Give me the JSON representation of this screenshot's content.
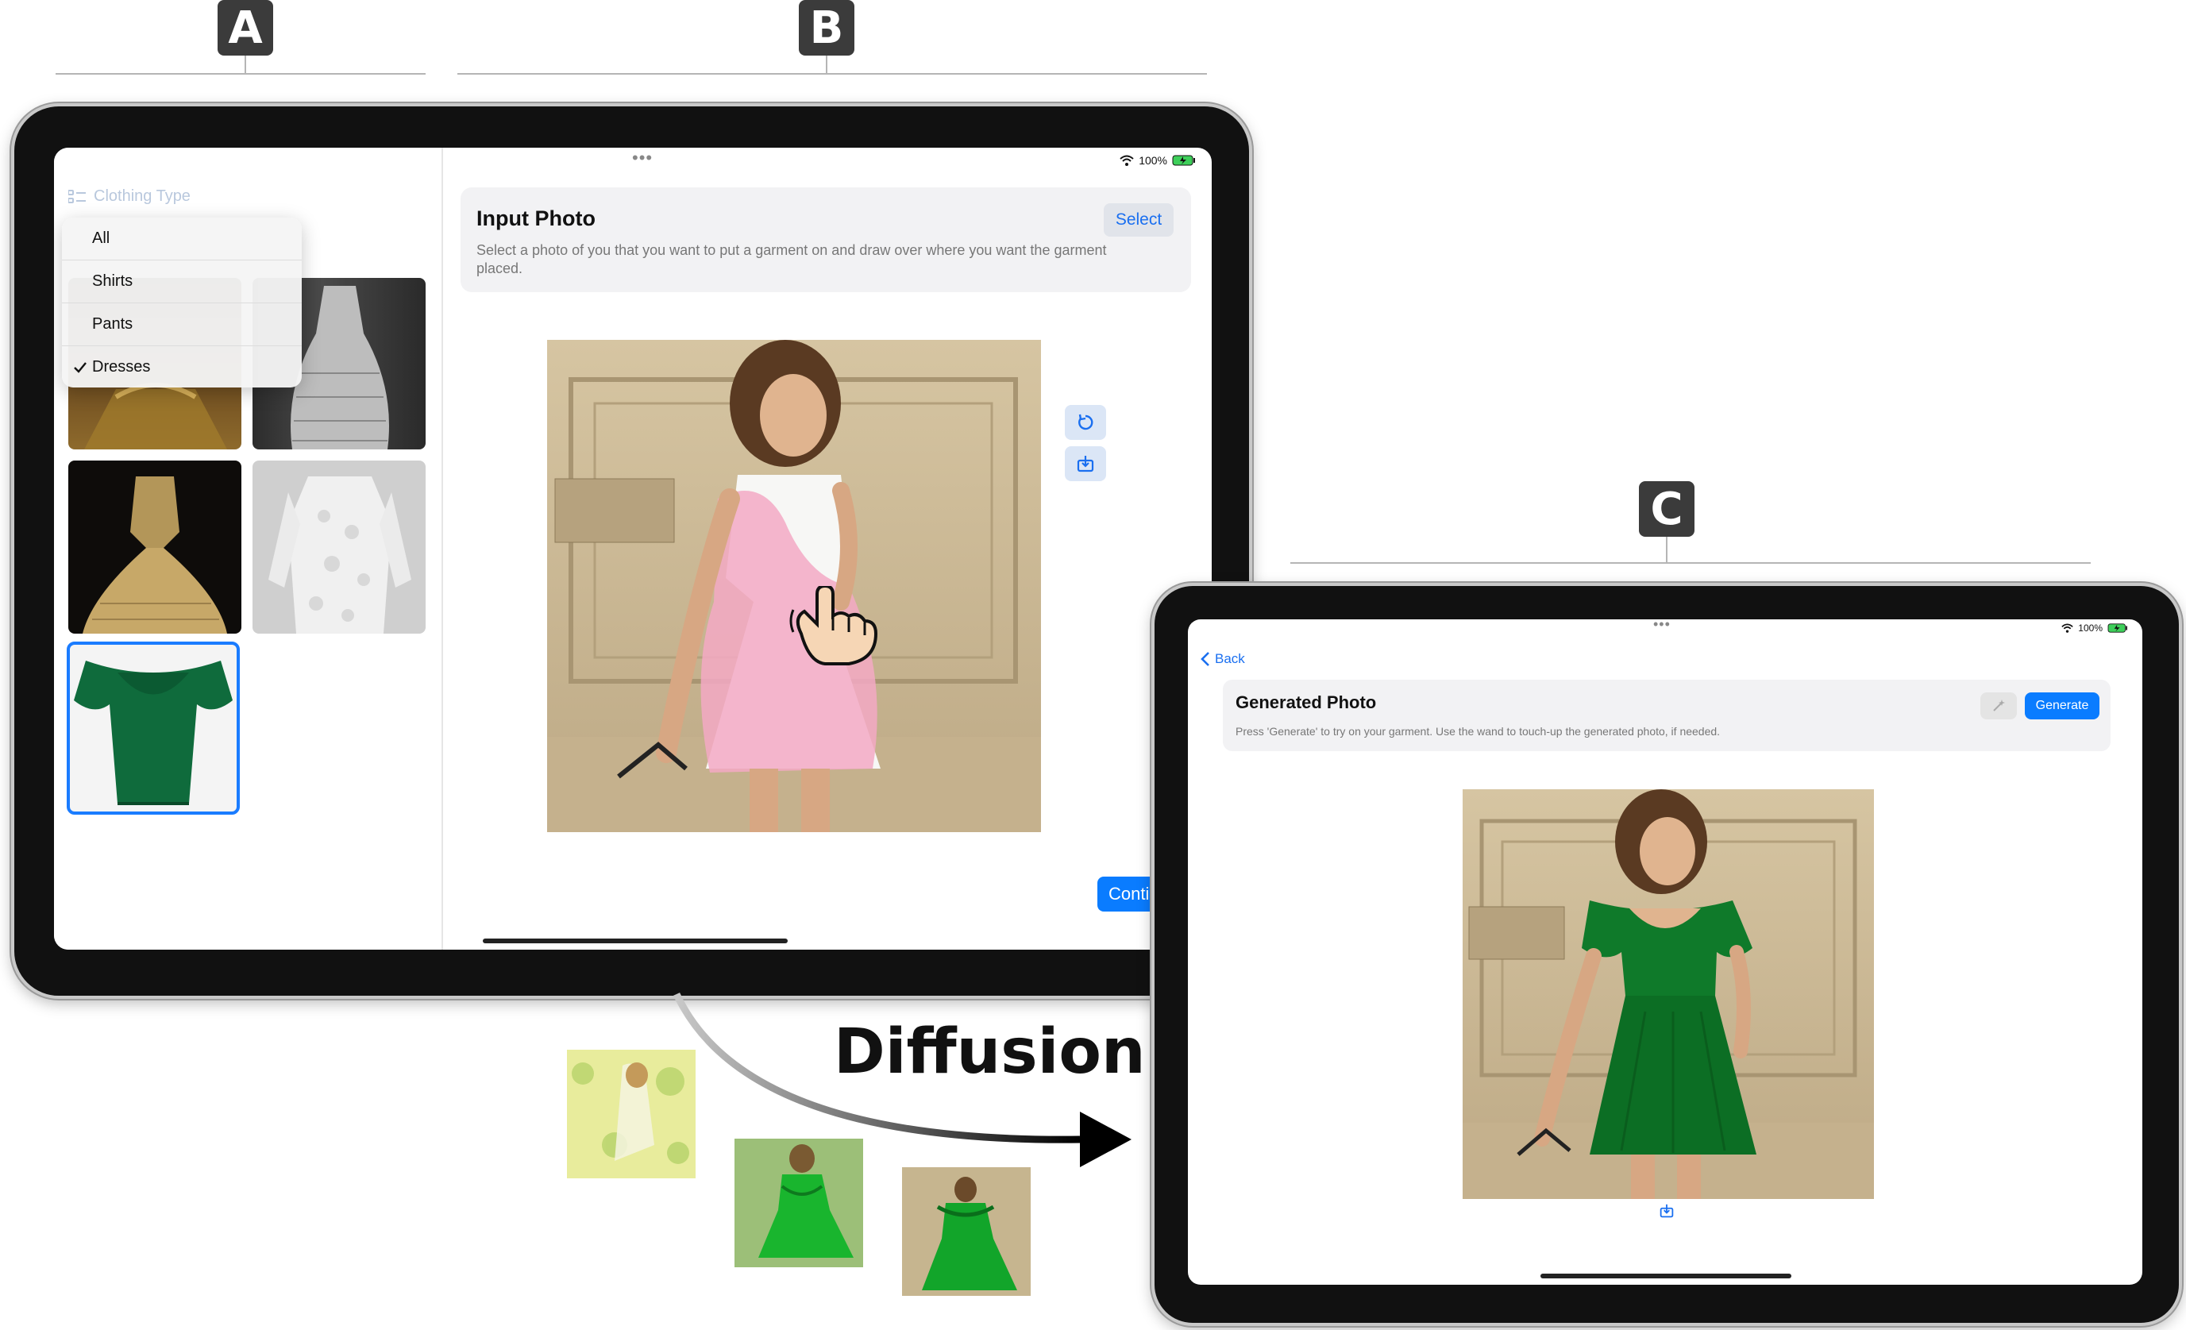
{
  "labels": {
    "a": "A",
    "b": "B",
    "c": "C"
  },
  "screen_ab": {
    "status": {
      "battery_text": "100%"
    },
    "sidebar": {
      "header": "Clothing Type",
      "menu": [
        {
          "label": "All",
          "checked": false
        },
        {
          "label": "Shirts",
          "checked": false
        },
        {
          "label": "Pants",
          "checked": false
        },
        {
          "label": "Dresses",
          "checked": true
        }
      ]
    },
    "input_card": {
      "title": "Input Photo",
      "description": "Select a photo of you that you want to put a garment on and draw over where you want the garment placed.",
      "select_label": "Select"
    },
    "continue_label": "Conti"
  },
  "diffusion_label": "Diffusion",
  "screen_c": {
    "status": {
      "battery_text": "100%"
    },
    "back_label": "Back",
    "generated_card": {
      "title": "Generated Photo",
      "description": "Press 'Generate' to try on your garment. Use the wand to touch-up the generated photo, if needed.",
      "generate_label": "Generate"
    }
  },
  "colors": {
    "accent_blue": "#0a7cff",
    "dress_green": "#0f7a3c",
    "mask_pink": "#f3a9c4",
    "label_dark": "#3b3b3b"
  },
  "icons": [
    "wifi-icon",
    "battery-icon",
    "list-icon",
    "checkmark-icon",
    "rotate-icon",
    "download-icon",
    "back-chevron-icon",
    "wand-icon",
    "hand-pointer-icon"
  ]
}
